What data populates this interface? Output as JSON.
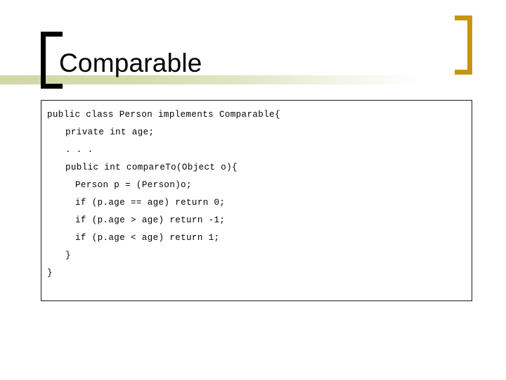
{
  "slide": {
    "title": "Comparable",
    "background_color": "#ffffff"
  },
  "decorations": {
    "left_bracket": "[",
    "right_bracket": "]",
    "left_bracket_color": "#000000",
    "right_bracket_color": "#c89411",
    "band_color": "#d2d8a4"
  },
  "code_block": {
    "lines": [
      {
        "text": "public class Person implements Comparable{",
        "indent": 0
      },
      {
        "text": "private int age;",
        "indent": 1
      },
      {
        "text": ". . .",
        "indent": 1
      },
      {
        "text": "public int compareTo(Object o){",
        "indent": 1
      },
      {
        "text": "Person p = (Person)o;",
        "indent": 2
      },
      {
        "text": "if (p.age == age) return 0;",
        "indent": 2
      },
      {
        "text": "if (p.age > age) return -1;",
        "indent": 2
      },
      {
        "text": "if (p.age < age) return 1;",
        "indent": 2
      },
      {
        "text": "}",
        "indent": 1
      },
      {
        "text": "}",
        "indent": 0
      }
    ]
  }
}
